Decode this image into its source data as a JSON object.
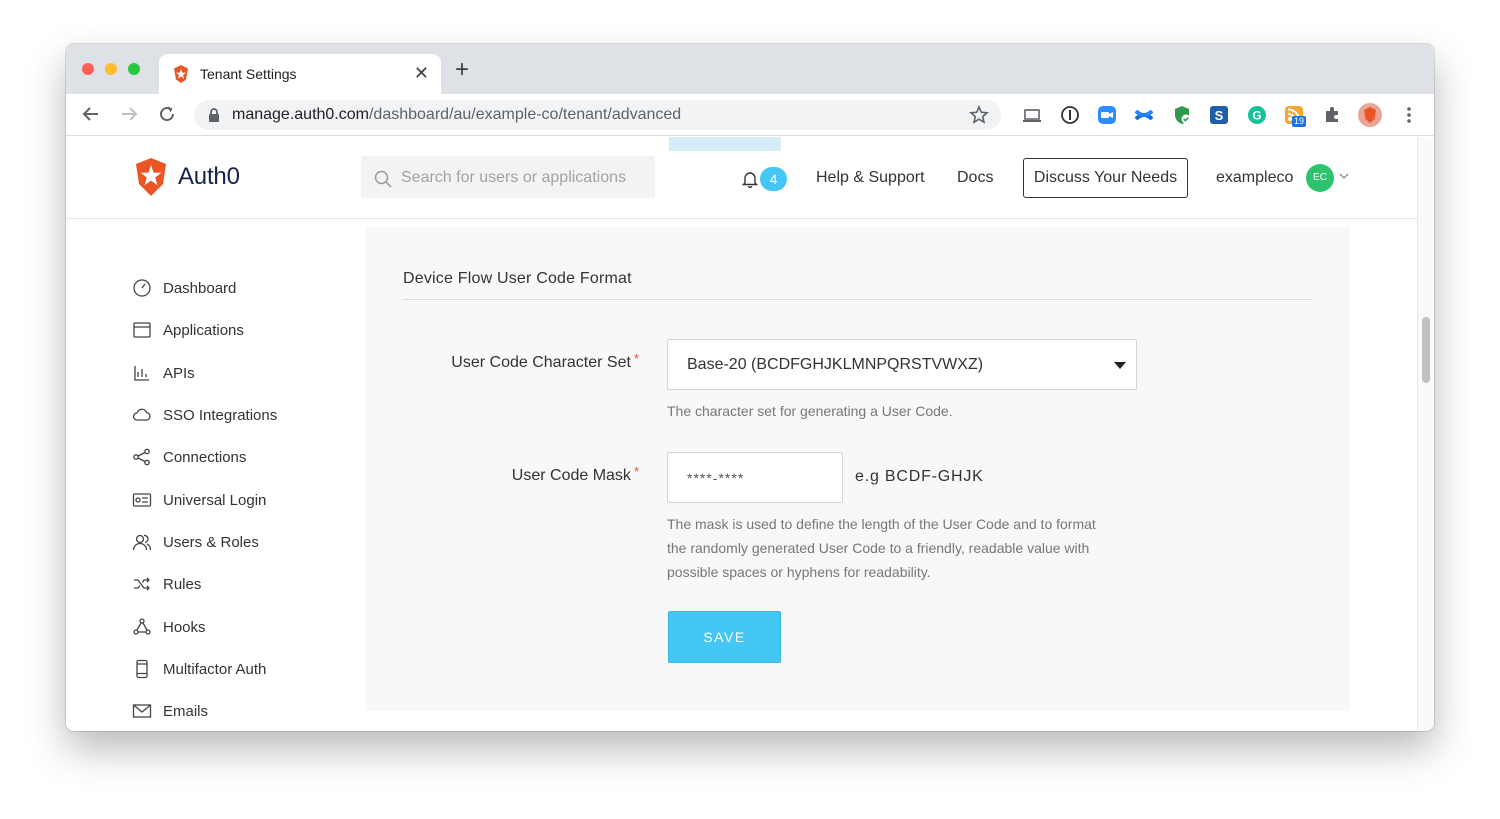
{
  "browser": {
    "tab_title": "Tenant Settings",
    "tab_close": "✕",
    "new_tab": "+",
    "url_host": "manage.auth0.com",
    "url_path": "/dashboard/au/example-co/tenant/advanced",
    "extension_badge": "19"
  },
  "header": {
    "logo_text": "Auth0",
    "search_placeholder": "Search for users or applications",
    "notification_count": "4",
    "help_link": "Help & Support",
    "docs_link": "Docs",
    "discuss_button": "Discuss Your Needs",
    "tenant_name": "exampleco",
    "avatar_initials": "EC"
  },
  "sidebar": {
    "items": [
      {
        "label": "Dashboard",
        "icon": "gauge-icon"
      },
      {
        "label": "Applications",
        "icon": "window-icon"
      },
      {
        "label": "APIs",
        "icon": "api-icon"
      },
      {
        "label": "SSO Integrations",
        "icon": "cloud-icon"
      },
      {
        "label": "Connections",
        "icon": "share-icon"
      },
      {
        "label": "Universal Login",
        "icon": "login-icon"
      },
      {
        "label": "Users & Roles",
        "icon": "users-icon"
      },
      {
        "label": "Rules",
        "icon": "shuffle-icon"
      },
      {
        "label": "Hooks",
        "icon": "hooks-icon"
      },
      {
        "label": "Multifactor Auth",
        "icon": "phone-icon"
      },
      {
        "label": "Emails",
        "icon": "mail-icon"
      }
    ]
  },
  "content": {
    "section_title": "Device Flow User Code Format",
    "charset_label": "User Code Character Set",
    "charset_value": "Base-20 (BCDFGHJKLMNPQRSTVWXZ)",
    "charset_help": "The character set for generating a User Code.",
    "mask_label": "User Code Mask",
    "mask_value": "****-****",
    "mask_example": "e.g BCDF-GHJK",
    "mask_help_1": "The mask is used to define the length of the User Code and to format",
    "mask_help_2": "the randomly generated User Code to a friendly, readable value with",
    "mask_help_3": "possible spaces or hyphens for readability.",
    "required_mark": "*",
    "save_button": "SAVE"
  },
  "colors": {
    "accent": "#44c7f4",
    "brand": "#eb5424",
    "avatar": "#2ec46f",
    "required": "#e34e3d"
  }
}
